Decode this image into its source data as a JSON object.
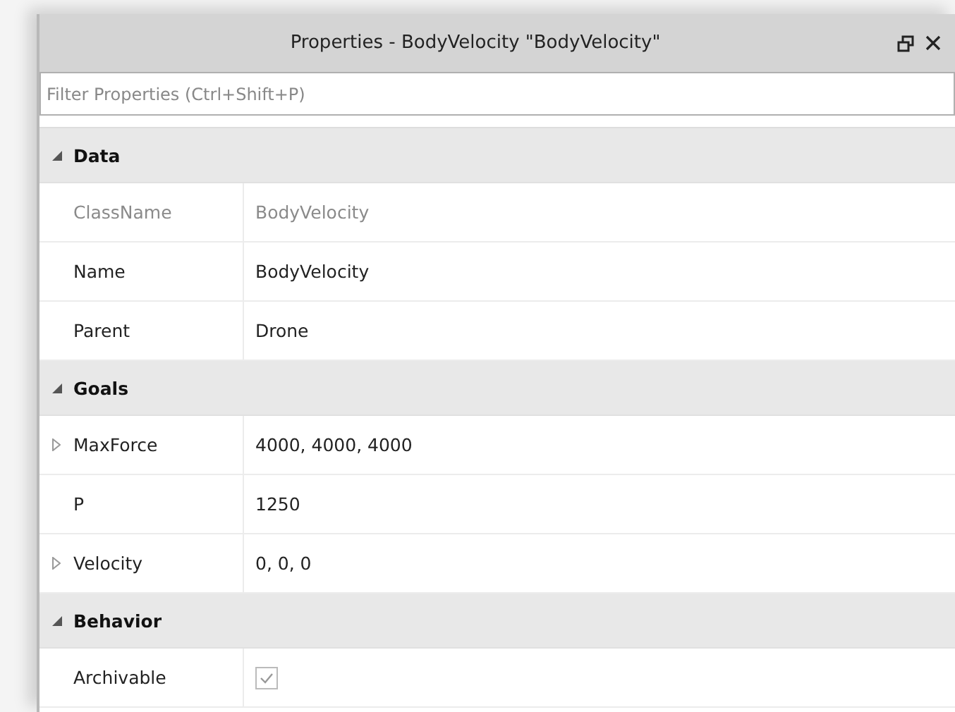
{
  "window": {
    "title": "Properties - BodyVelocity \"BodyVelocity\""
  },
  "filter": {
    "placeholder": "Filter Properties (Ctrl+Shift+P)"
  },
  "sections": [
    {
      "name": "Data",
      "expanded": true,
      "properties": [
        {
          "kind": "text",
          "name": "ClassName",
          "value": "BodyVelocity",
          "disabled": true,
          "expandable": false
        },
        {
          "kind": "text",
          "name": "Name",
          "value": "BodyVelocity",
          "disabled": false,
          "expandable": false
        },
        {
          "kind": "text",
          "name": "Parent",
          "value": "Drone",
          "disabled": false,
          "expandable": false
        }
      ]
    },
    {
      "name": "Goals",
      "expanded": true,
      "properties": [
        {
          "kind": "text",
          "name": "MaxForce",
          "value": "4000, 4000, 4000",
          "disabled": false,
          "expandable": true
        },
        {
          "kind": "text",
          "name": "P",
          "value": "1250",
          "disabled": false,
          "expandable": false
        },
        {
          "kind": "text",
          "name": "Velocity",
          "value": "0, 0, 0",
          "disabled": false,
          "expandable": true
        }
      ]
    },
    {
      "name": "Behavior",
      "expanded": true,
      "properties": [
        {
          "kind": "checkbox",
          "name": "Archivable",
          "checked": true,
          "disabled": false,
          "expandable": false
        }
      ]
    }
  ]
}
